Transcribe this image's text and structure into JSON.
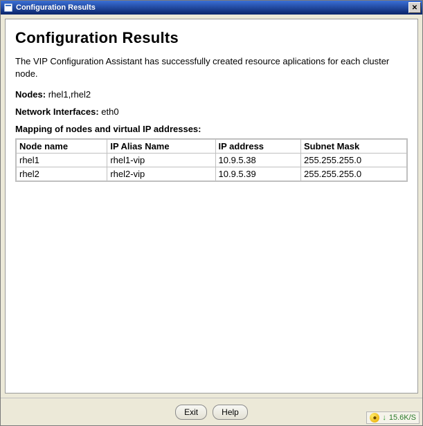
{
  "window": {
    "title": "Configuration Results"
  },
  "page": {
    "heading": "Configuration Results",
    "description": "The VIP Configuration Assistant has successfully created resource aplications for each cluster node.",
    "nodes_label": "Nodes:",
    "nodes_value": "rhel1,rhel2",
    "netif_label": "Network Interfaces:",
    "netif_value": "eth0",
    "mapping_label": "Mapping of nodes and virtual IP addresses:"
  },
  "table": {
    "headers": [
      "Node name",
      "IP Alias Name",
      "IP address",
      "Subnet Mask"
    ],
    "rows": [
      {
        "node": "rhel1",
        "alias": "rhel1-vip",
        "ip": "10.9.5.38",
        "mask": "255.255.255.0"
      },
      {
        "node": "rhel2",
        "alias": "rhel2-vip",
        "ip": "10.9.5.39",
        "mask": "255.255.255.0"
      }
    ]
  },
  "buttons": {
    "exit": "Exit",
    "help": "Help"
  },
  "status": {
    "rate": "15.6K/S"
  }
}
